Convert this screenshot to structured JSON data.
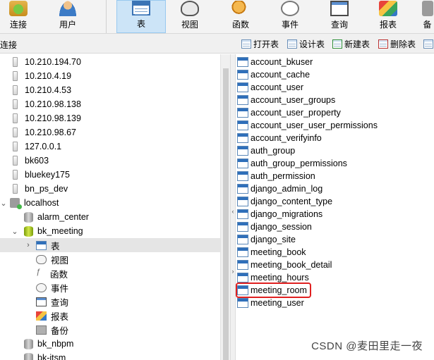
{
  "toolbar": {
    "buttons": [
      {
        "label": "连接",
        "icon": "connection-icon"
      },
      {
        "label": "用户",
        "icon": "user-icon"
      },
      {
        "label": "表",
        "icon": "table-icon",
        "active": true
      },
      {
        "label": "视图",
        "icon": "view-icon"
      },
      {
        "label": "函数",
        "icon": "function-icon"
      },
      {
        "label": "事件",
        "icon": "event-icon"
      },
      {
        "label": "查询",
        "icon": "query-icon"
      },
      {
        "label": "报表",
        "icon": "report-icon"
      },
      {
        "label": "备",
        "icon": "backup-icon"
      }
    ]
  },
  "subbar": {
    "left_label": "连接",
    "actions": [
      {
        "label": "打开表"
      },
      {
        "label": "设计表"
      },
      {
        "label": "新建表"
      },
      {
        "label": "删除表"
      }
    ]
  },
  "tree": {
    "servers": [
      "10.210.194.70",
      "10.210.4.19",
      "10.210.4.53",
      "10.210.98.138",
      "10.210.98.139",
      "10.210.98.67",
      "127.0.0.1",
      "bk603",
      "bluekey175",
      "bn_ps_dev"
    ],
    "host": "localhost",
    "databases": [
      "alarm_center",
      "bk_meeting"
    ],
    "objects": [
      {
        "label": "表",
        "icon": "table-icon",
        "selected": true
      },
      {
        "label": "视图",
        "icon": "view-icon"
      },
      {
        "label": "函数",
        "icon": "function-icon"
      },
      {
        "label": "事件",
        "icon": "event-icon"
      },
      {
        "label": "查询",
        "icon": "query-icon"
      },
      {
        "label": "报表",
        "icon": "report-icon"
      },
      {
        "label": "备份",
        "icon": "backup-icon"
      }
    ],
    "more_databases": [
      "bk_nbpm",
      "bk-itsm"
    ]
  },
  "tables": [
    "account_bkuser",
    "account_cache",
    "account_user",
    "account_user_groups",
    "account_user_property",
    "account_user_user_permissions",
    "account_verifyinfo",
    "auth_group",
    "auth_group_permissions",
    "auth_permission",
    "django_admin_log",
    "django_content_type",
    "django_migrations",
    "django_session",
    "django_site",
    "meeting_book",
    "meeting_book_detail",
    "meeting_hours",
    "meeting_room",
    "meeting_user"
  ],
  "highlighted_table": "meeting_room",
  "watermark": "CSDN @麦田里走一夜",
  "colors": {
    "highlight_border": "#e02020",
    "active_tab": "#cce4f7"
  }
}
